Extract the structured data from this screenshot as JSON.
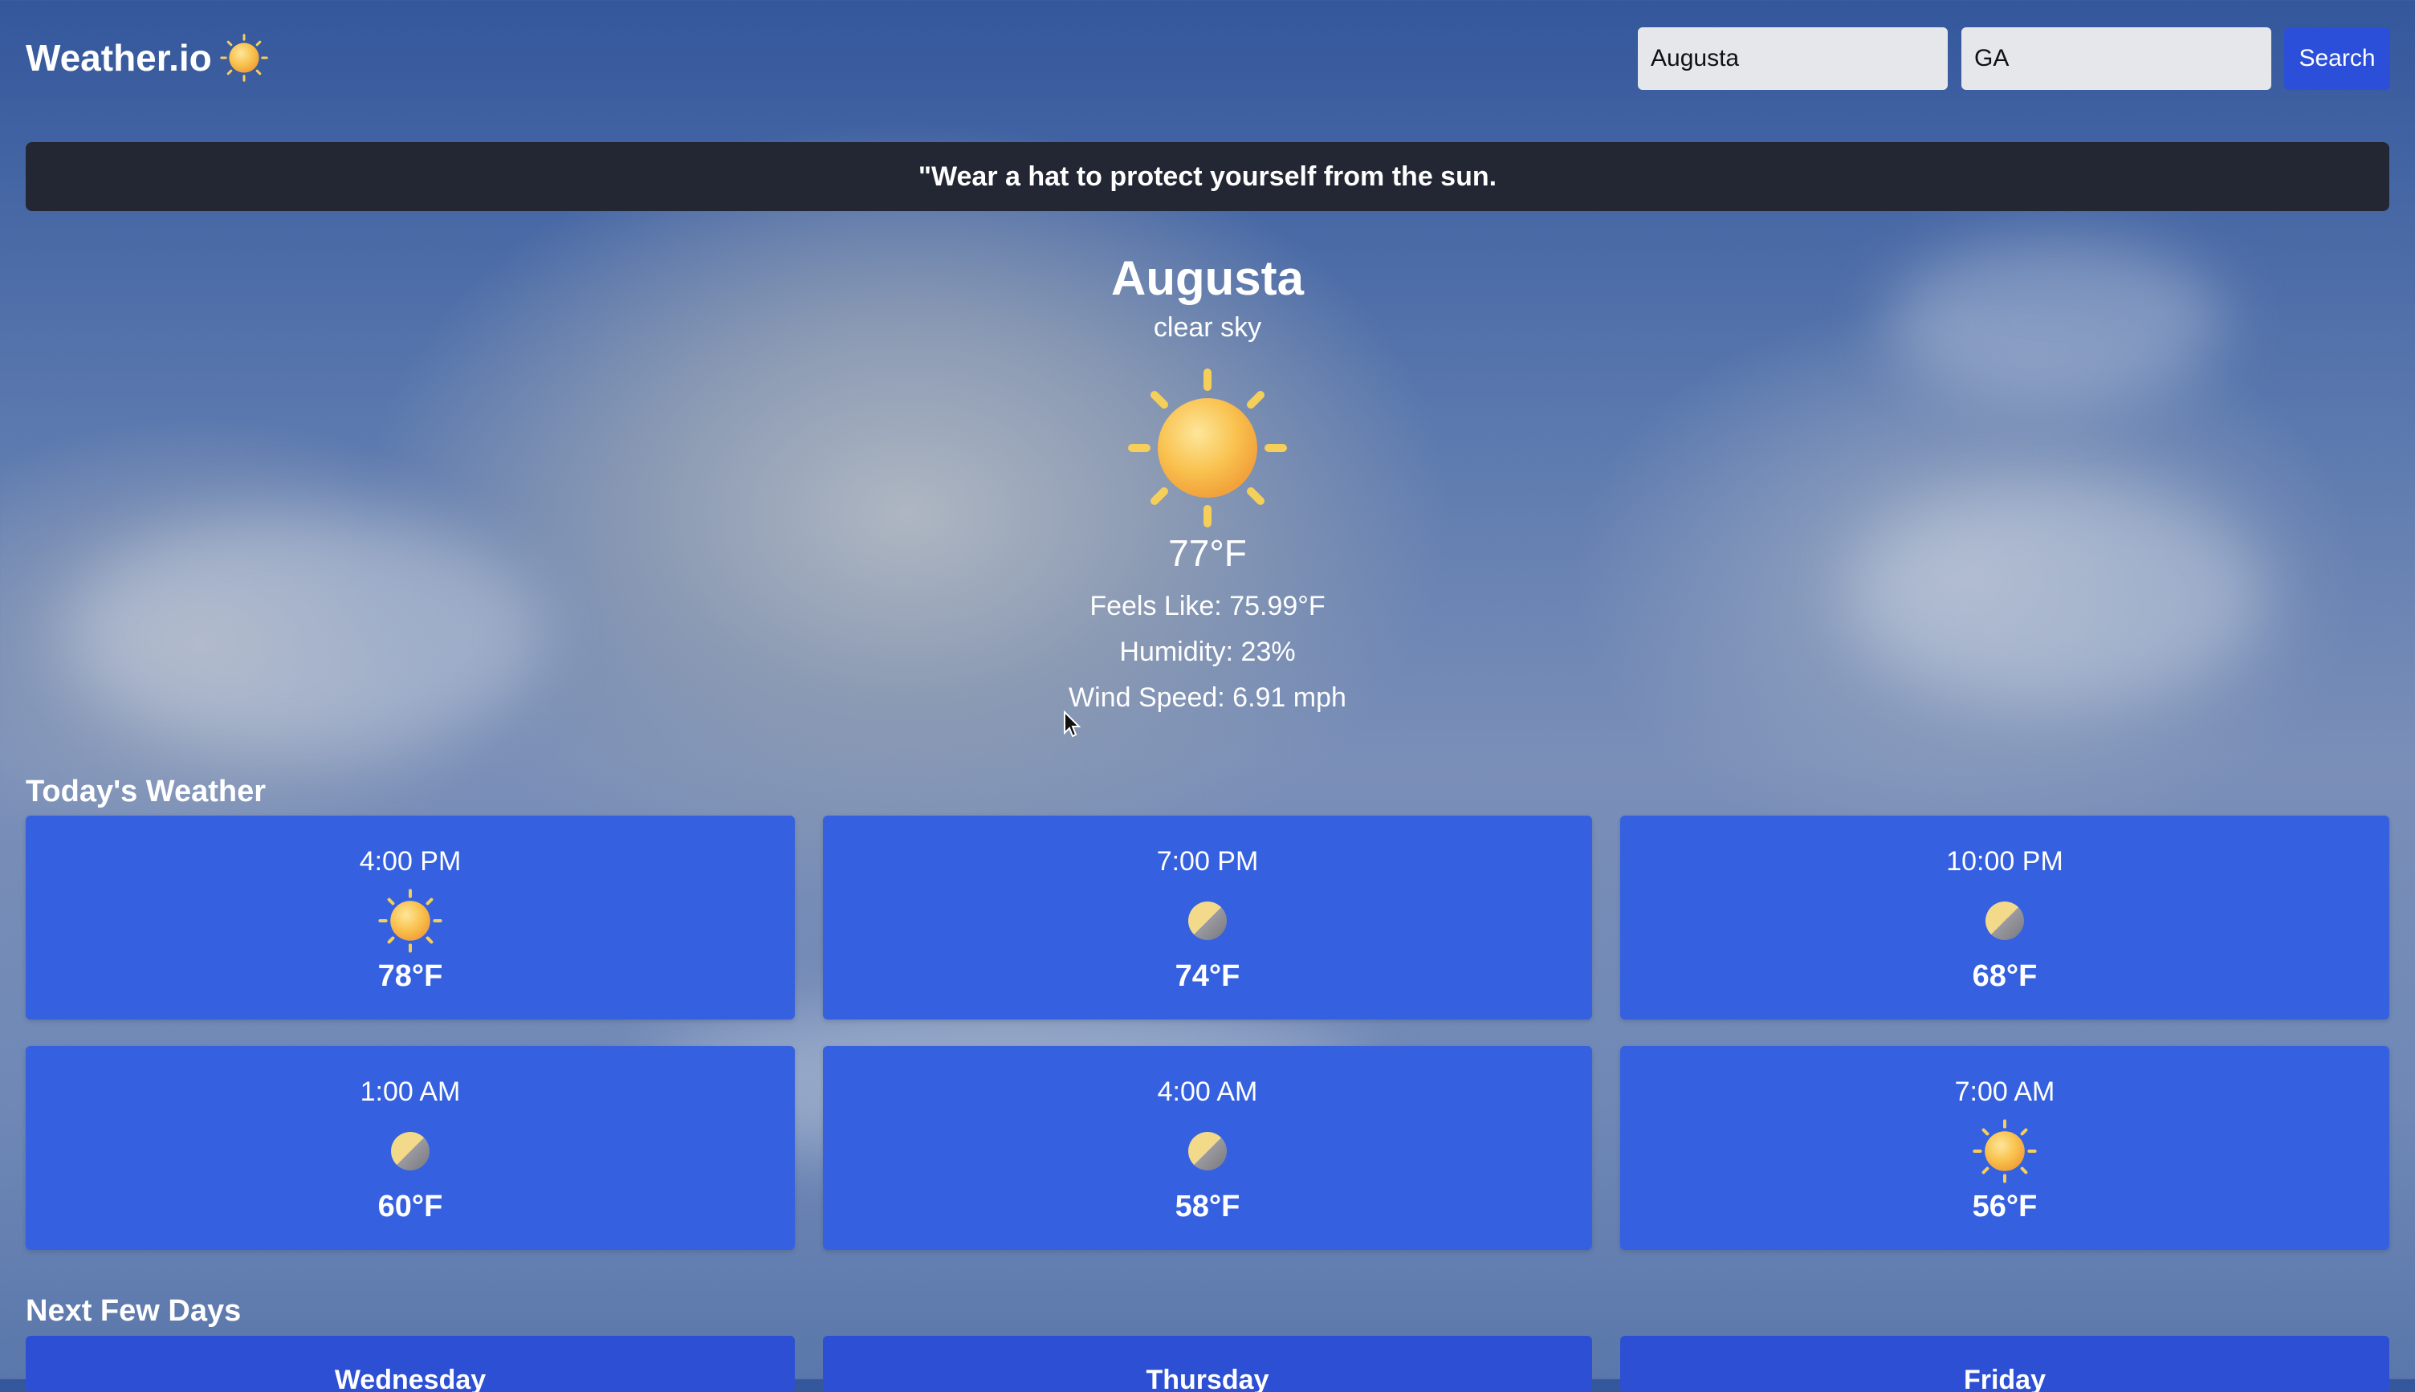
{
  "app": {
    "title": "Weather.io"
  },
  "search": {
    "city_value": "Augusta",
    "state_value": "GA",
    "button_label": "Search"
  },
  "tip": {
    "text": "\"Wear a hat to protect yourself from the sun."
  },
  "current": {
    "city": "Augusta",
    "condition": "clear sky",
    "icon": "sun-icon",
    "temp": "77°F",
    "feels_like": "Feels Like: 75.99°F",
    "humidity": "Humidity: 23%",
    "wind": "Wind Speed: 6.91 mph"
  },
  "today": {
    "title": "Today's Weather",
    "hours": [
      {
        "time": "4:00 PM",
        "icon": "sun-icon",
        "temp": "78°F"
      },
      {
        "time": "7:00 PM",
        "icon": "moon-icon",
        "temp": "74°F"
      },
      {
        "time": "10:00 PM",
        "icon": "moon-icon",
        "temp": "68°F"
      },
      {
        "time": "1:00 AM",
        "icon": "moon-icon",
        "temp": "60°F"
      },
      {
        "time": "4:00 AM",
        "icon": "moon-icon",
        "temp": "58°F"
      },
      {
        "time": "7:00 AM",
        "icon": "sun-icon",
        "temp": "56°F"
      }
    ]
  },
  "forecast": {
    "title": "Next Few Days",
    "days": [
      {
        "day": "Wednesday"
      },
      {
        "day": "Thursday"
      },
      {
        "day": "Friday"
      }
    ]
  },
  "colors": {
    "card": "#3561e0",
    "search_button": "#2b4fd8",
    "banner": "#232733"
  }
}
